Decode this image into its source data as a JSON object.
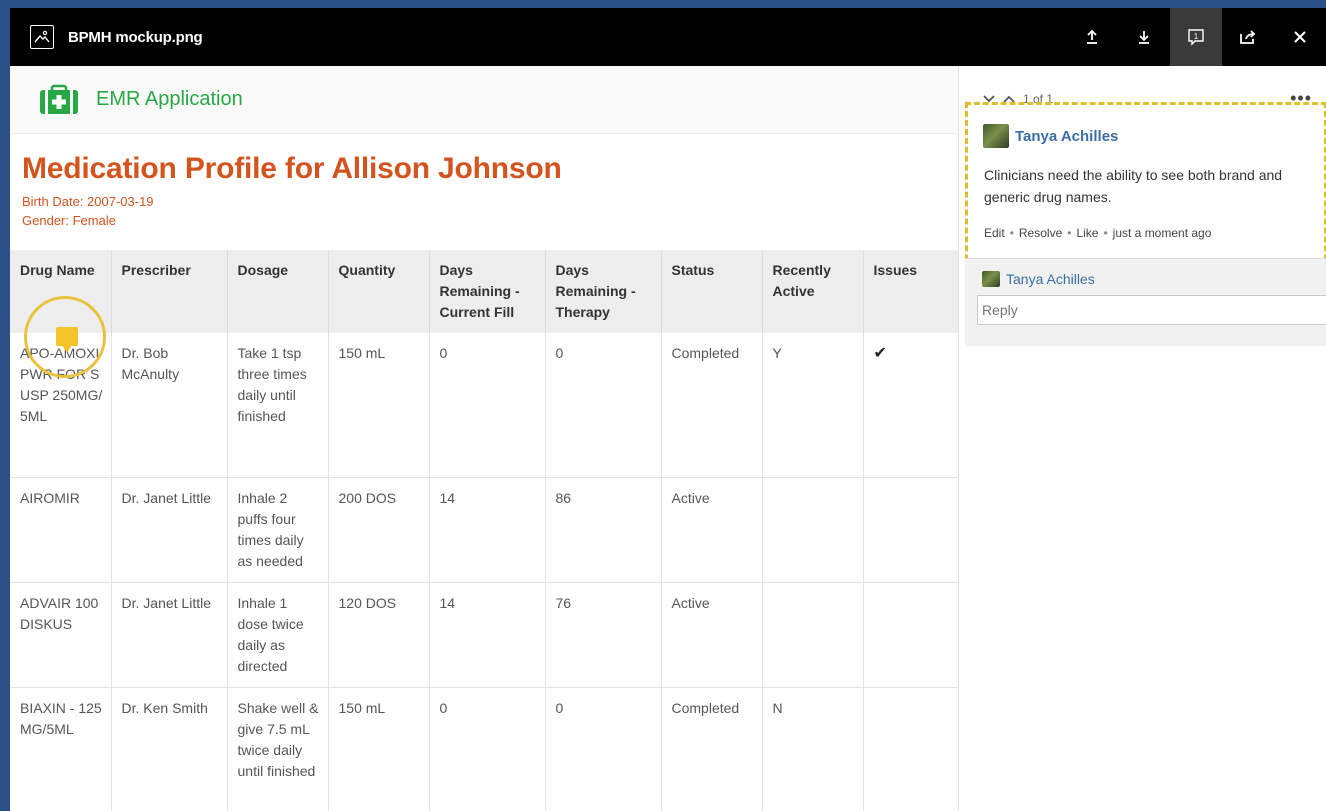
{
  "window": {
    "file_name": "BPMH mockup.png"
  },
  "app": {
    "name": "EMR Application",
    "brand_color": "#27a844"
  },
  "profile": {
    "title": "Medication Profile for Allison Johnson",
    "birth_date": "Birth Date: 2007-03-19",
    "gender": "Gender: Female",
    "accent_color": "#d3541f"
  },
  "table": {
    "headers": [
      "Drug Name",
      "Prescriber",
      "Dosage",
      "Quantity",
      "Days Remaining - Current Fill",
      "Days Remaining - Therapy",
      "Status",
      "Recently Active",
      "Issues"
    ],
    "rows": [
      [
        "APO-AMOXI PWR FOR SUSP 250MG/5ML",
        "Dr. Bob McAnulty",
        "Take 1 tsp three times daily until finished",
        "150 mL",
        "0",
        "0",
        "Completed",
        "Y",
        "✔"
      ],
      [
        "AIROMIR",
        "Dr. Janet Little",
        "Inhale 2 puffs four times daily as needed",
        "200 DOS",
        "14",
        "86",
        "Active",
        "",
        ""
      ],
      [
        "ADVAIR 100 DISKUS",
        "Dr. Janet Little",
        "Inhale 1 dose twice daily as directed",
        "120 DOS",
        "14",
        "76",
        "Active",
        "",
        ""
      ],
      [
        "BIAXIN - 125MG/5ML",
        "Dr. Ken Smith",
        "Shake well & give 7.5 mL twice daily until finished",
        "150 mL",
        "0",
        "0",
        "Completed",
        "N",
        ""
      ]
    ]
  },
  "comments": {
    "nav_label": "1 of 1",
    "author": "Tanya Achilles",
    "text": "Clinicians need the ability to see both brand and generic drug names.",
    "actions": [
      "Edit",
      "Resolve",
      "Like",
      "just a moment ago"
    ],
    "reply_author": "Tanya Achilles",
    "reply_placeholder": "Reply",
    "highlight_color": "#dcbf2c"
  }
}
